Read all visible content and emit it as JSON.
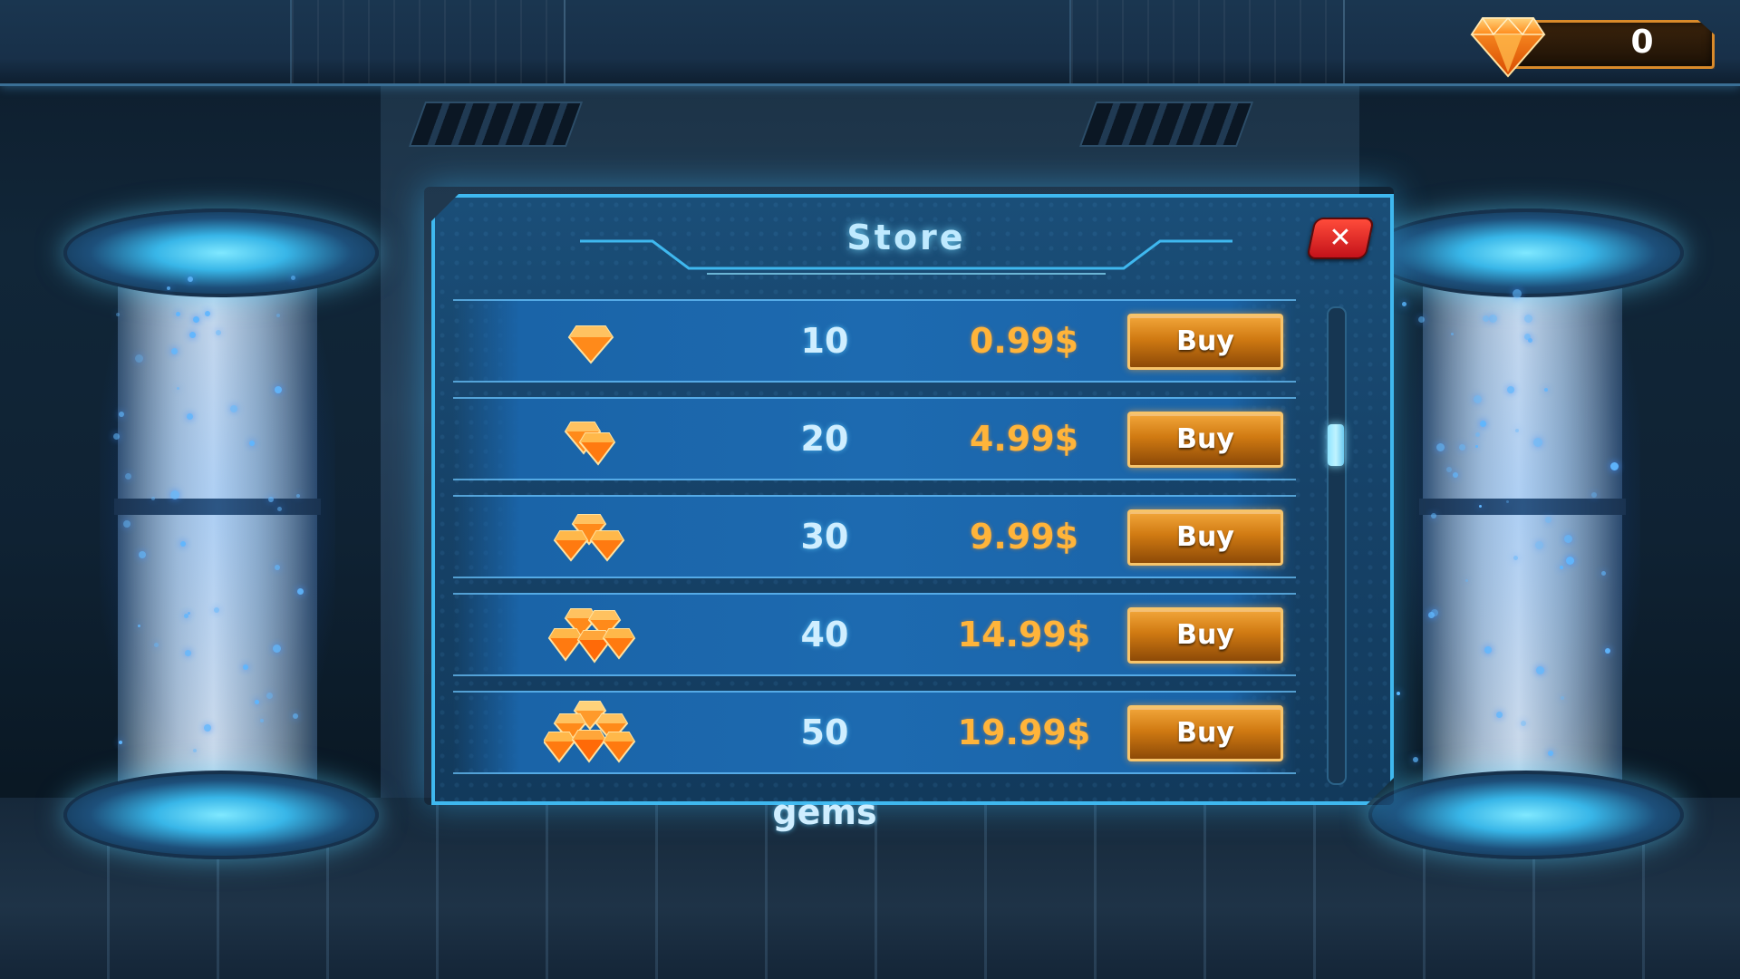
{
  "currency": {
    "icon": "gem-icon",
    "value": "0"
  },
  "store": {
    "title": "Store",
    "close_icon": "close-icon",
    "items": [
      {
        "amount": "10 gems",
        "price": "0.99$",
        "buy_label": "Buy",
        "icon": "gem-single-icon"
      },
      {
        "amount": "20 gems",
        "price": "4.99$",
        "buy_label": "Buy",
        "icon": "gem-pair-icon"
      },
      {
        "amount": "30 gems",
        "price": "9.99$",
        "buy_label": "Buy",
        "icon": "gem-small-pile-icon"
      },
      {
        "amount": "40 gems",
        "price": "14.99$",
        "buy_label": "Buy",
        "icon": "gem-pile-icon"
      },
      {
        "amount": "50 gems",
        "price": "19.99$",
        "buy_label": "Buy",
        "icon": "gem-large-pile-icon"
      }
    ]
  },
  "colors": {
    "panel_border": "#3fb8ef",
    "panel_fill": "#164268",
    "price_text": "#ffb43a",
    "amount_text": "#cfeeff",
    "buy_button": "#d07a12",
    "close_button": "#c4121a"
  }
}
